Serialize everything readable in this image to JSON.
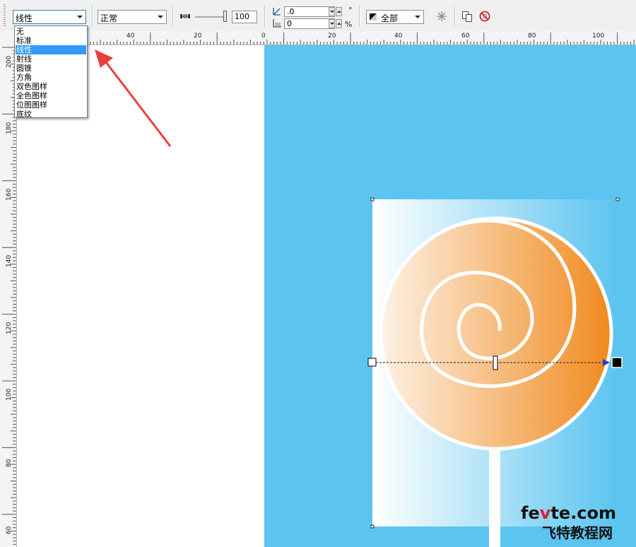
{
  "toolbar": {
    "fill_type": "线性",
    "blend_mode": "正常",
    "opacity": "100",
    "angle_value": ".0",
    "angle_unit": "°",
    "edge_value": "0",
    "edge_unit": "%",
    "target": "全部"
  },
  "fill_type_options": [
    "无",
    "标准",
    "线性",
    "射线",
    "圆锥",
    "方角",
    "双色图样",
    "全色图样",
    "位图图样",
    "底纹"
  ],
  "fill_type_selected_index": 2,
  "ruler_top": {
    "labels": [
      "40",
      "20",
      "0",
      "20",
      "40",
      "60",
      "80",
      "100"
    ]
  },
  "ruler_left": {
    "labels": [
      "200",
      "180",
      "160",
      "140",
      "120",
      "100",
      "80",
      "60"
    ]
  },
  "watermark": {
    "line1_a": "fe",
    "line1_b": "v",
    "line1_c": "te.com",
    "line2": "飞特教程网"
  },
  "colors": {
    "page_blue": "#5bc4f0",
    "candy_orange": "#f0902a",
    "selection_blue": "#3399ff",
    "arrow_red": "#e8413a"
  }
}
